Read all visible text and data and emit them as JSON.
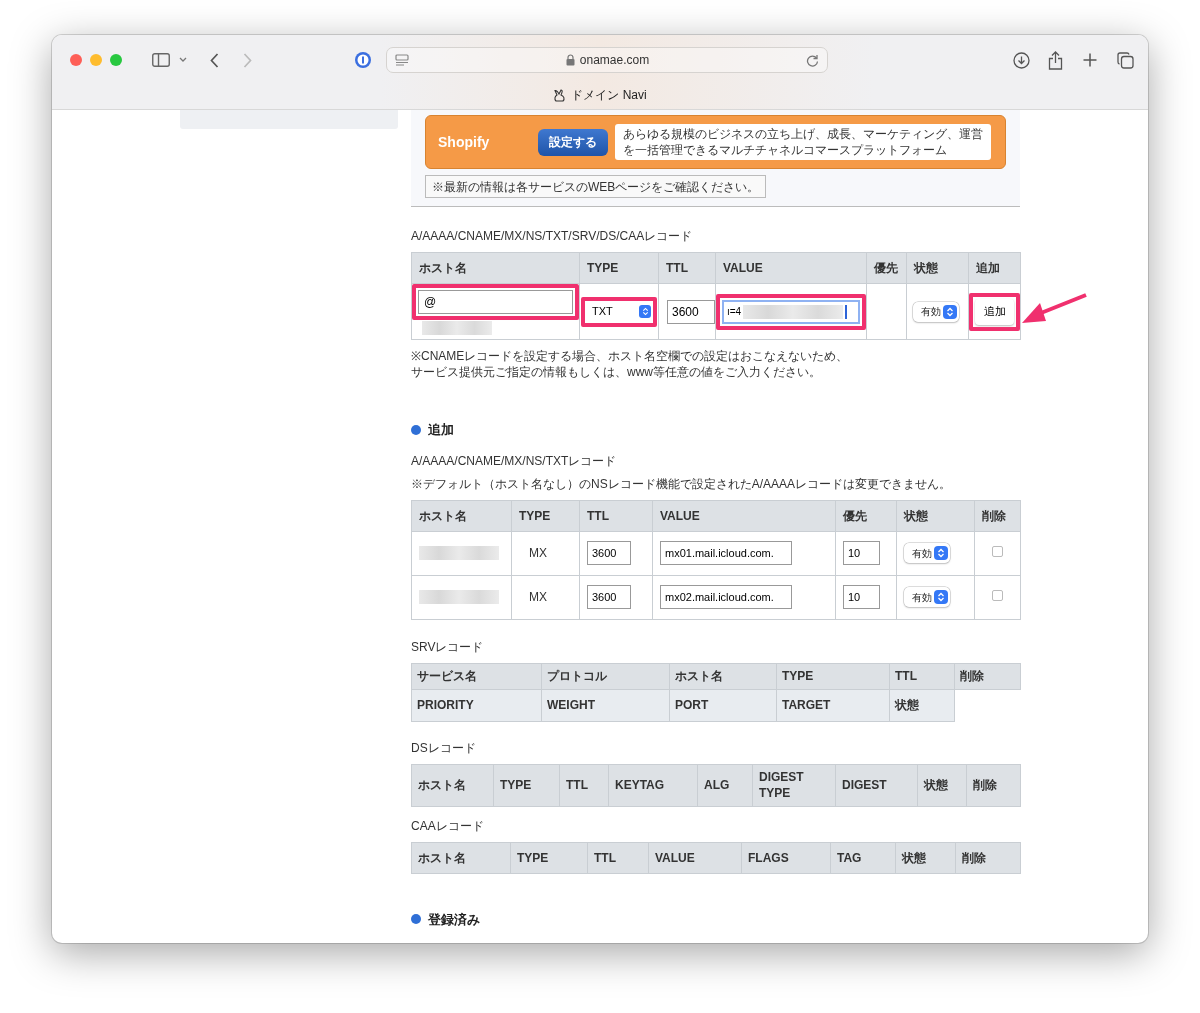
{
  "browser": {
    "url": "onamae.com",
    "tab_title": "ドメイン Navi"
  },
  "banner": {
    "name": "Shopify",
    "button": "設定する",
    "description": "あらゆる規模のビジネスの立ち上げ、成長、マーケティング、運営を一括管理できるマルチチャネルコマースプラットフォーム"
  },
  "notice": "※最新の情報は各サービスのWEBページをご確認ください。",
  "entry_form": {
    "title": "A/AAAA/CNAME/MX/NS/TXT/SRV/DS/CAAレコード",
    "columns": [
      "ホスト名",
      "TYPE",
      "TTL",
      "VALUE",
      "優先",
      "状態",
      "追加"
    ],
    "row": {
      "host": {
        "value": "@",
        "highlighted": true
      },
      "type": {
        "value": "TXT",
        "highlighted": true
      },
      "ttl": {
        "value": "3600",
        "highlighted": false
      },
      "value": {
        "value": "ı=4",
        "highlighted": true
      },
      "status": "有効",
      "add_button": {
        "label": "追加",
        "highlighted": true
      }
    },
    "notes": [
      "※CNAMEレコードを設定する場合、ホスト名空欄での設定はおこなえないため、",
      "サービス提供元ご指定の情報もしくは、www等任意の値をご入力ください。"
    ]
  },
  "add_section": {
    "heading": "追加",
    "title": "A/AAAA/CNAME/MX/NS/TXTレコード",
    "note": "※デフォルト（ホスト名なし）のNSレコード機能で設定されたA/AAAAレコードは変更できません。",
    "columns": [
      "ホスト名",
      "TYPE",
      "TTL",
      "VALUE",
      "優先",
      "状態",
      "削除"
    ],
    "rows": [
      {
        "type": "MX",
        "ttl": "3600",
        "value": "mx01.mail.icloud.com.",
        "priority": "10",
        "status": "有効",
        "checked": false
      },
      {
        "type": "MX",
        "ttl": "3600",
        "value": "mx02.mail.icloud.com.",
        "priority": "10",
        "status": "有効",
        "checked": false
      }
    ]
  },
  "srv": {
    "title": "SRVレコード",
    "header_row_1": [
      "サービス名",
      "プロトコル",
      "ホスト名",
      "TYPE",
      "TTL",
      "削除"
    ],
    "header_row_2": [
      "PRIORITY",
      "WEIGHT",
      "PORT",
      "TARGET",
      "状態"
    ]
  },
  "ds": {
    "title": "DSレコード",
    "columns": [
      "ホスト名",
      "TYPE",
      "TTL",
      "KEYTAG",
      "ALG",
      "DIGEST TYPE",
      "DIGEST",
      "状態",
      "削除"
    ]
  },
  "caa": {
    "title": "CAAレコード",
    "columns": [
      "ホスト名",
      "TYPE",
      "TTL",
      "VALUE",
      "FLAGS",
      "TAG",
      "状態",
      "削除"
    ]
  },
  "registered_heading": "登録済み"
}
